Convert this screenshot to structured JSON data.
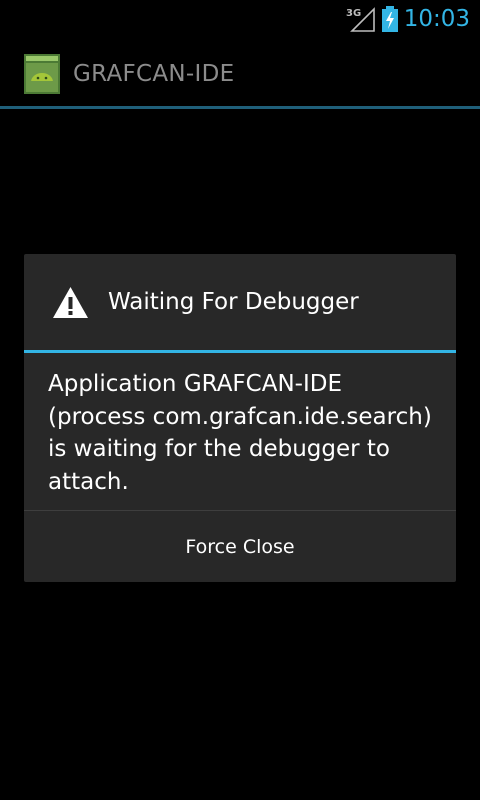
{
  "status_bar": {
    "network_type": "3G",
    "time": "10:03",
    "signal_icon": "signal-3g-icon",
    "battery_icon": "battery-charging-icon",
    "accent_color": "#33b5e5"
  },
  "action_bar": {
    "icon": "android-app-icon",
    "title": "GRAFCAN-IDE"
  },
  "dialog": {
    "icon": "warning-icon",
    "title": "Waiting For Debugger",
    "message": "Application GRAFCAN-IDE (process com.grafcan.ide.search) is waiting for the debugger to attach.",
    "button_label": "Force Close",
    "accent_color": "#33b5e5"
  }
}
